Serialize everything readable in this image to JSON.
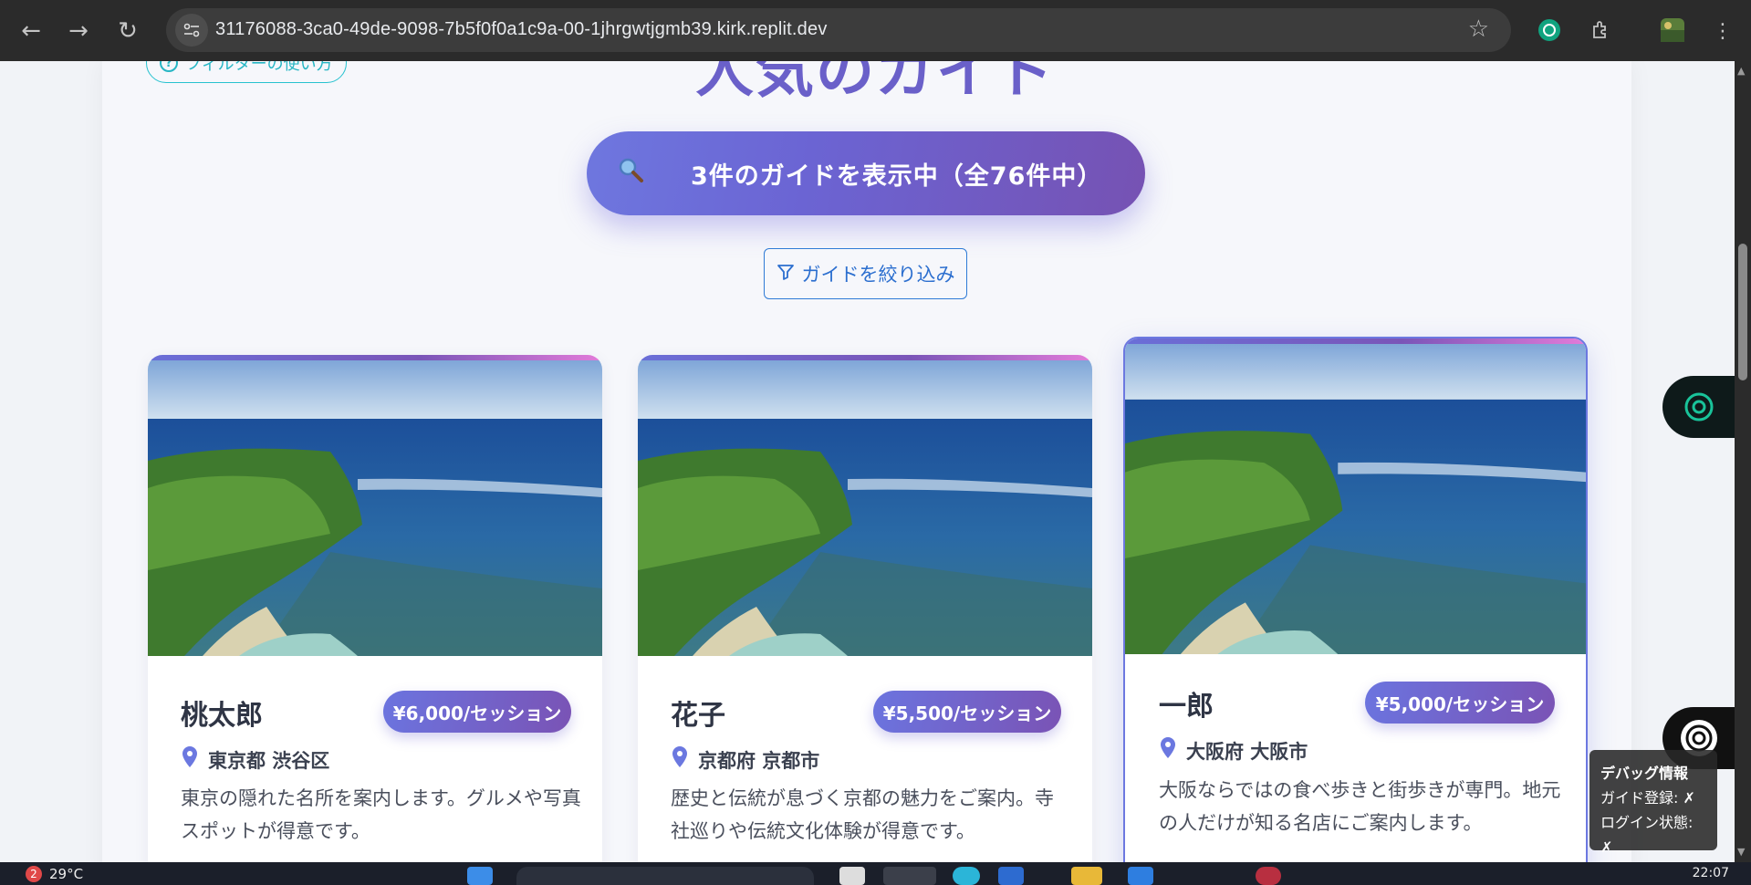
{
  "browser": {
    "url": "31176088-3ca0-49de-9098-7b5f0f0a1c9a-00-1jhrgwtjgmb39.kirk.replit.dev"
  },
  "page": {
    "help_link": "フィルターの使い方",
    "section_title": "人気のガイド",
    "result_count": "3件のガイドを表示中（全76件中）",
    "filter_button": "ガイドを絞り込み"
  },
  "guides": [
    {
      "name": "桃太郎",
      "price": "¥6,000/セッション",
      "location": "東京都 渋谷区",
      "description_line1": "東京の隠れた名所を案内します。グルメや写真",
      "description_line2": "スポットが得意です。"
    },
    {
      "name": "花子",
      "price": "¥5,500/セッション",
      "location": "京都府 京都市",
      "description_line1": "歴史と伝統が息づく京都の魅力をご案内。寺",
      "description_line2": "社巡りや伝統文化体験が得意です。"
    },
    {
      "name": "一郎",
      "price": "¥5,000/セッション",
      "location": "大阪府 大阪市",
      "description_line1": "大阪ならではの食べ歩きと街歩きが専門。地元",
      "description_line2": "の人だけが知る名店にご案内します。"
    }
  ],
  "debug": {
    "title": "デバッグ情報",
    "guide_registered": "ガイド登録: ✗",
    "login_status": "ログイン状態: ✗"
  },
  "taskbar": {
    "badge": "2",
    "temperature": "29°C",
    "time": "22:07"
  },
  "colors": {
    "accent": "#6b64d3",
    "accent_end": "#7652b3",
    "cyan": "#27c2cf",
    "filter_blue": "#2f7bd6"
  }
}
